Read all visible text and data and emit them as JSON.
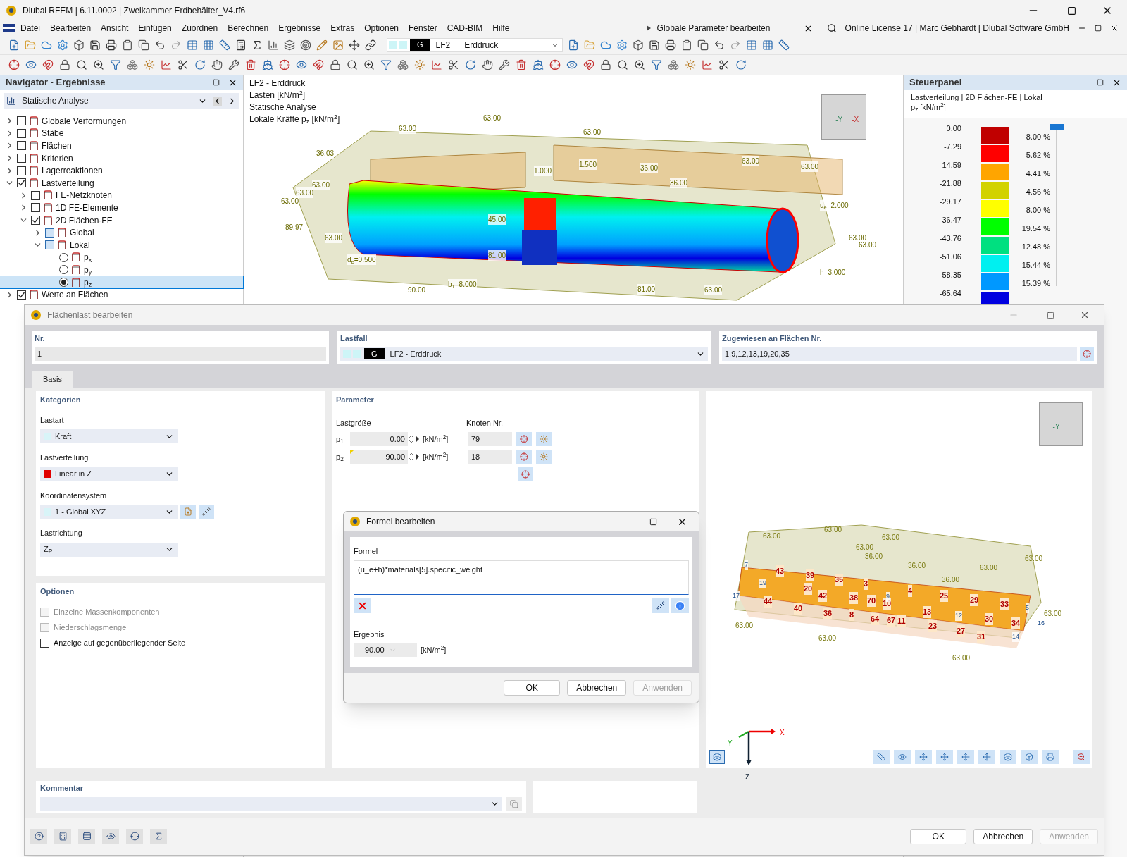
{
  "window": {
    "title": "Dlubal RFEM | 6.11.0002 | Zweikammer Erdbehälter_V4.rf6"
  },
  "menu": [
    "Datei",
    "Bearbeiten",
    "Ansicht",
    "Einfügen",
    "Zuordnen",
    "Berechnen",
    "Ergebnisse",
    "Extras",
    "Optionen",
    "Fenster",
    "CAD-BIM",
    "Hilfe"
  ],
  "global_params": "Globale Parameter bearbeiten",
  "license": "Online License 17 | Marc Gebhardt | Dlubal Software GmbH",
  "load_case_selector": {
    "tag": "G",
    "code": "LF2",
    "name": "Erddruck"
  },
  "navigator": {
    "title": "Navigator - Ergebnisse",
    "selector": "Statische Analyse",
    "tree": [
      {
        "label": "Globale Verformungen",
        "kind": "checkbox",
        "checked": false,
        "expanded": false
      },
      {
        "label": "Stäbe",
        "kind": "checkbox",
        "checked": false,
        "expanded": false
      },
      {
        "label": "Flächen",
        "kind": "checkbox",
        "checked": false,
        "expanded": false
      },
      {
        "label": "Kriterien",
        "kind": "checkbox",
        "checked": false,
        "expanded": false
      },
      {
        "label": "Lagerreaktionen",
        "kind": "checkbox",
        "checked": false,
        "expanded": false
      },
      {
        "label": "Lastverteilung",
        "kind": "checkbox",
        "checked": true,
        "expanded": true,
        "children": [
          {
            "label": "FE-Netzknoten",
            "kind": "checkbox",
            "checked": false,
            "expanded": false
          },
          {
            "label": "1D FE-Elemente",
            "kind": "checkbox",
            "checked": false,
            "expanded": false
          },
          {
            "label": "2D Flächen-FE",
            "kind": "checkbox",
            "checked": true,
            "expanded": true,
            "children": [
              {
                "label": "Global",
                "kind": "partial",
                "expanded": false
              },
              {
                "label": "Lokal",
                "kind": "partial",
                "expanded": true,
                "children": [
                  {
                    "label": "p$_{x}$",
                    "kind": "radio",
                    "selected": false
                  },
                  {
                    "label": "p$_{y}$",
                    "kind": "radio",
                    "selected": false
                  },
                  {
                    "label": "p$_{z}$",
                    "kind": "radio",
                    "selected": true
                  }
                ]
              }
            ]
          }
        ]
      },
      {
        "label": "Werte an Flächen",
        "kind": "checkbox",
        "checked": true,
        "expanded": false
      }
    ]
  },
  "viewport": {
    "info": [
      "LF2 - Erddruck",
      "Lasten [kN/m$^{2}$]",
      "Statische Analyse",
      "Lokale Kräfte p$_{z}$ [kN/m$^{2}$]"
    ],
    "cube_labels": [
      "-Y",
      "-X"
    ],
    "labels": [
      "63.00",
      "63.00",
      "63.00",
      "36.03",
      "1.000",
      "1.500",
      "36.00",
      "63.00",
      "63.00",
      "36.00",
      "63.00",
      "63.00",
      "63.00",
      "89.97",
      "45.00",
      "63.00",
      "81.00",
      "d$_{e}$=0.500",
      "63.00",
      "63.00",
      "b$_{1}$=8.000",
      "90.00",
      "81.00",
      "63.00",
      "u$_{e}$=2.000",
      "h=3.000"
    ]
  },
  "control_panel": {
    "title": "Steuerpanel",
    "subtitle": "Lastverteilung | 2D Flächen-FE | Lokal",
    "unit": "p$_{z}$ [kN/m$^{2}$]",
    "legend": [
      {
        "value": "0.00",
        "color": "#c00000",
        "percent": "8.00 %"
      },
      {
        "value": "-7.29",
        "color": "#ff0000",
        "percent": "5.62 %"
      },
      {
        "value": "-14.59",
        "color": "#ffa500",
        "percent": "4.41 %"
      },
      {
        "value": "-21.88",
        "color": "#d2d200",
        "percent": "4.56 %"
      },
      {
        "value": "-29.17",
        "color": "#ffff00",
        "percent": "8.00 %"
      },
      {
        "value": "-36.47",
        "color": "#00ff00",
        "percent": "19.54 %"
      },
      {
        "value": "-43.76",
        "color": "#00e080",
        "percent": "12.48 %"
      },
      {
        "value": "-51.06",
        "color": "#00f0f0",
        "percent": "15.44 %"
      },
      {
        "value": "-58.35",
        "color": "#0098ff",
        "percent": "15.39 %"
      },
      {
        "value": "-65.64",
        "color": "#0000e0"
      }
    ]
  },
  "dialog": {
    "title": "Flächenlast bearbeiten",
    "nr": {
      "label": "Nr.",
      "value": "1"
    },
    "load_case": {
      "label": "Lastfall",
      "tag": "G",
      "value": "LF2 - Erddruck"
    },
    "assigned": {
      "label": "Zugewiesen an Flächen Nr.",
      "value": "1,9,12,13,19,20,35"
    },
    "tabs": [
      {
        "label": "Basis",
        "selected": true
      }
    ],
    "categories": {
      "title": "Kategorien",
      "fields": [
        {
          "label": "Lastart",
          "value": "Kraft",
          "color": "#d8f4f8"
        },
        {
          "label": "Lastverteilung",
          "value": "Linear in Z",
          "color": "#e00000"
        },
        {
          "label": "Koordinatensystem",
          "value": "1 - Global XYZ",
          "color": "#d8f4f8"
        },
        {
          "label": "Lastrichtung",
          "value": "Z$_{P}$"
        }
      ]
    },
    "options": {
      "title": "Optionen",
      "items": [
        {
          "label": "Einzelne Massenkomponenten",
          "checked": false,
          "disabled": true
        },
        {
          "label": "Niederschlagsmenge",
          "checked": false,
          "disabled": true
        },
        {
          "label": "Anzeige auf gegenüberliegender Seite",
          "checked": false,
          "disabled": false
        }
      ]
    },
    "parameters": {
      "title": "Parameter",
      "magnitude_label": "Lastgröße",
      "node_label": "Knoten Nr.",
      "rows": [
        {
          "name": "p$_{1}$",
          "value": "0.00",
          "unit": "[kN/m$^{2}$]",
          "node": "79",
          "formula": false
        },
        {
          "name": "p$_{2}$",
          "value": "90.00",
          "unit": "[kN/m$^{2}$]",
          "node": "18",
          "formula": true
        }
      ]
    },
    "preview": {
      "cube_labels": [
        "-Y"
      ],
      "labels": [
        {
          "text": "63.00",
          "kind": "value"
        },
        {
          "text": "63.00",
          "kind": "value"
        },
        {
          "text": "63.00",
          "kind": "value"
        },
        {
          "text": "63.00",
          "kind": "value"
        },
        {
          "text": "36.00",
          "kind": "value"
        },
        {
          "text": "63.00",
          "kind": "value"
        },
        {
          "text": "36.00",
          "kind": "value"
        },
        {
          "text": "63.00",
          "kind": "value"
        },
        {
          "text": "36.00",
          "kind": "value"
        },
        {
          "text": "43",
          "kind": "node"
        },
        {
          "text": "39",
          "kind": "node"
        },
        {
          "text": "35",
          "kind": "node"
        },
        {
          "text": "3",
          "kind": "node"
        },
        {
          "text": "20",
          "kind": "node"
        },
        {
          "text": "42",
          "kind": "node"
        },
        {
          "text": "38",
          "kind": "node"
        },
        {
          "text": "70",
          "kind": "node"
        },
        {
          "text": "10",
          "kind": "node"
        },
        {
          "text": "4",
          "kind": "node"
        },
        {
          "text": "25",
          "kind": "node"
        },
        {
          "text": "29",
          "kind": "node"
        },
        {
          "text": "33",
          "kind": "node"
        },
        {
          "text": "44",
          "kind": "node"
        },
        {
          "text": "40",
          "kind": "node"
        },
        {
          "text": "36",
          "kind": "node"
        },
        {
          "text": "8",
          "kind": "node"
        },
        {
          "text": "64",
          "kind": "node"
        },
        {
          "text": "67",
          "kind": "node"
        },
        {
          "text": "11",
          "kind": "node"
        },
        {
          "text": "13",
          "kind": "node"
        },
        {
          "text": "23",
          "kind": "node"
        },
        {
          "text": "27",
          "kind": "node"
        },
        {
          "text": "30",
          "kind": "node"
        },
        {
          "text": "31",
          "kind": "node"
        },
        {
          "text": "34",
          "kind": "node"
        },
        {
          "text": "7",
          "kind": "line"
        },
        {
          "text": "19",
          "kind": "line"
        },
        {
          "text": "17",
          "kind": "line"
        },
        {
          "text": "9",
          "kind": "line"
        },
        {
          "text": "12",
          "kind": "line"
        },
        {
          "text": "5",
          "kind": "line"
        },
        {
          "text": "16",
          "kind": "line"
        },
        {
          "text": "14",
          "kind": "line"
        },
        {
          "text": "63.00",
          "kind": "value"
        },
        {
          "text": "63.00",
          "kind": "value"
        },
        {
          "text": "63.00",
          "kind": "value"
        },
        {
          "text": "63.00",
          "kind": "value"
        }
      ],
      "axes": [
        "X",
        "Y",
        "Z"
      ]
    },
    "comment": {
      "title": "Kommentar"
    },
    "buttons": [
      {
        "label": "OK",
        "disabled": false
      },
      {
        "label": "Abbrechen",
        "disabled": false
      },
      {
        "label": "Anwenden",
        "disabled": true
      }
    ]
  },
  "formula_dialog": {
    "title": "Formel bearbeiten",
    "formula_label": "Formel",
    "formula": "(u_e+h)*materials[5].specific_weight",
    "result_label": "Ergebnis",
    "result": "90.00",
    "unit": "[kN/m$^{2}$]",
    "buttons": [
      {
        "label": "OK",
        "disabled": false
      },
      {
        "label": "Abbrechen",
        "disabled": false
      },
      {
        "label": "Anwenden",
        "disabled": true
      }
    ]
  }
}
